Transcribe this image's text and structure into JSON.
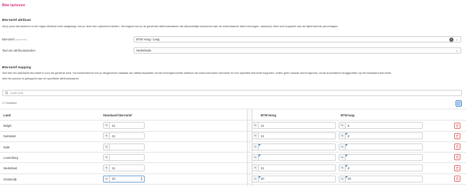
{
  "page": {
    "title": "Btw tarieven"
  },
  "attributes_section": {
    "heading": "Btw-tarief attribuut",
    "description": "Als je jouw btw-tarieven in een eigen attribuut hebt vastgelegd, kun je deze hier optioneel instellen. Vervolgens kun je de gewenste attribuutwaarden als afzonderlijke kolommen aan de onderstaande tabel toevoegen, waarna je deze kunt koppelen aan de bijbehorende percentages.",
    "attribute_label": "Btw-tarief",
    "attribute_hint": "(optioneel)",
    "attribute_value": "BTW Hoog / Laag",
    "language_label": "Taal van attribuutwaarden",
    "language_value": "Nederlands"
  },
  "mapping_section": {
    "heading": "Btw-tarief mapping",
    "description_line1": "Stel hier het standaard btw-tarief in voor elk gewenst land. Via kolomheltever kun je desgewenst maaltaal van attribuutwaarden uit het bovengenoemde attribuut als extra kolommen hieronder en een specifiek btw-tarief koppelen. Indien geen waarde wordt ingevuld, wordt automatisch teruggevallen op het standaard btw-tarief,",
    "description_line2": "mits het product is gekoppeld aan de specifieke attribuutwaarde.",
    "search_placeholder": "Zoek land",
    "result_count": "17 resultaten"
  },
  "table": {
    "headers": {
      "country": "Land",
      "default": "Standaard btw-tarief",
      "col1": "BTW Hoog",
      "col2": "BTW laag"
    },
    "percent_symbol": "%",
    "rows": [
      {
        "country": "België",
        "default": "21",
        "hoog": "21",
        "laag": "6",
        "hoog_mark": false,
        "laag_mark": false
      },
      {
        "country": "Duitsland",
        "default": "21",
        "hoog": "21",
        "laag": "6",
        "hoog_mark": false,
        "laag_mark": true
      },
      {
        "country": "Italië",
        "default": "",
        "hoog": "",
        "laag": "",
        "hoog_mark": true,
        "laag_mark": true
      },
      {
        "country": "Luxemburg",
        "default": "",
        "hoog": "",
        "laag": "",
        "hoog_mark": true,
        "laag_mark": true
      },
      {
        "country": "Nederland",
        "default": "21",
        "hoog": "21",
        "laag": "9",
        "hoog_mark": false,
        "laag_mark": true
      },
      {
        "country": "Oostenrijk",
        "default": "20",
        "hoog": "20",
        "laag": "20",
        "hoog_mark": true,
        "laag_mark": true
      }
    ]
  },
  "colors": {
    "accent": "#d6337e",
    "link_blue": "#3b82c4",
    "delete_red": "#e06b6b"
  }
}
